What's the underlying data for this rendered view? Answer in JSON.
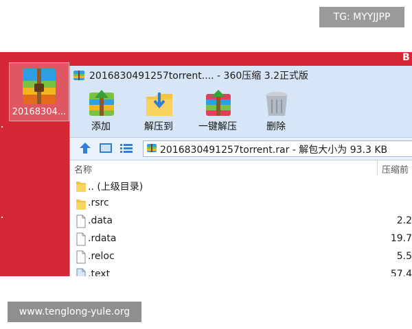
{
  "watermarks": {
    "top_right": "TG: MYYJJPP",
    "bottom_left": "www.tenglong-yule.org"
  },
  "desktop": {
    "icon_label": "20168304...",
    "edge_letter": "B"
  },
  "window": {
    "title": "2016830491257torrent.... - 360压缩 3.2正式版",
    "toolbar": {
      "add_label": "添加",
      "extract_to_label": "解压到",
      "one_click_extract_label": "一键解压",
      "delete_label": "删除"
    },
    "address": {
      "path_text": "2016830491257torrent.rar - 解包大小为 93.3 KB"
    },
    "columns": {
      "name": "名称",
      "compressed_size": "压缩前"
    },
    "files": [
      {
        "name": ".. (上级目录)",
        "size": "",
        "icon": "folder-icon"
      },
      {
        "name": ".rsrc",
        "size": "",
        "icon": "folder-icon"
      },
      {
        "name": ".data",
        "size": "2.2",
        "icon": "file-icon"
      },
      {
        "name": ".rdata",
        "size": "19.7",
        "icon": "file-icon"
      },
      {
        "name": ".reloc",
        "size": "5.5",
        "icon": "file-icon"
      },
      {
        "name": ".text",
        "size": "57.4",
        "icon": "file-icon"
      }
    ]
  },
  "colors": {
    "desktop_bg": "#d52836",
    "window_chrome": "#d7e6f7",
    "accent_blue": "#2f7fd6"
  }
}
